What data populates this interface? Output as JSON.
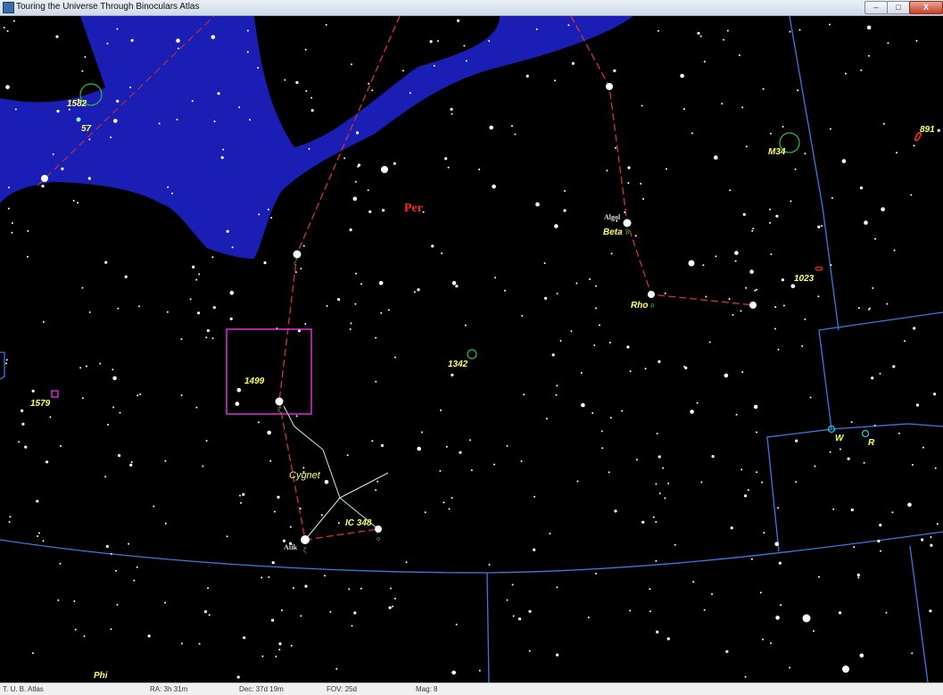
{
  "window": {
    "title": "Touring the Universe Through Binoculars Atlas",
    "buttons": {
      "minimize": "–",
      "maximize": "□",
      "close": "X"
    }
  },
  "colors": {
    "background": "#000000",
    "milky_way": "#1b1eb4",
    "boundary": "#3a78e6",
    "stick_figure": "#d8322e",
    "asterism": "#c8ece6",
    "label": "#ffff66",
    "open_cluster": "#22c043",
    "galaxy": "#ff2a1e",
    "variable": "#28c8d8",
    "marker": "#ff33ff",
    "constellation_name": "#ff2222"
  },
  "chart": {
    "constellation_name": "Per",
    "star_names": [
      "Algol",
      "Atik"
    ],
    "greek_labels": [
      "Beta",
      "Rho",
      "Phi",
      "W",
      "R"
    ],
    "asterism_name": "Cygnet",
    "deep_sky": [
      {
        "label": "1582",
        "kind": "open-cluster",
        "icon": "open-cluster-icon"
      },
      {
        "label": "57",
        "kind": "open-cluster",
        "icon": "open-cluster-icon"
      },
      {
        "label": "M34",
        "kind": "open-cluster",
        "icon": "open-cluster-icon"
      },
      {
        "label": "891",
        "kind": "galaxy",
        "icon": "galaxy-icon"
      },
      {
        "label": "1023",
        "kind": "galaxy",
        "icon": "galaxy-icon"
      },
      {
        "label": "1342",
        "kind": "open-cluster",
        "icon": "open-cluster-icon"
      },
      {
        "label": "1499",
        "kind": "nebula",
        "icon": "nebula-box-icon"
      },
      {
        "label": "1579",
        "kind": "nebula",
        "icon": "nebula-box-icon"
      },
      {
        "label": "IC 348",
        "kind": "open-cluster",
        "icon": "open-cluster-icon"
      }
    ]
  },
  "status": {
    "app": "T. U. B. Atlas",
    "ra": "RA: 3h 31m",
    "dec": "Dec: 37d 19m",
    "fov": "FOV: 25d",
    "mag": "Mag: 8"
  }
}
